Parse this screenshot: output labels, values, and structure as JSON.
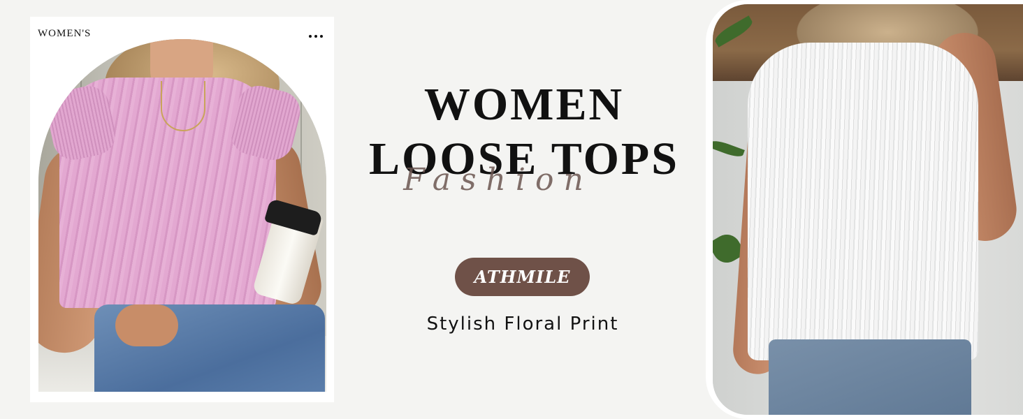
{
  "left_card": {
    "label": "WOMEN'S",
    "more_icon": "more-dots-icon",
    "photo_alt": "Woman in pink textured sleeveless top holding coffee cup"
  },
  "center": {
    "headline_line1": "WOMEN",
    "headline_line2": "LOOSE TOPS",
    "script_word": "Fashion",
    "brand_badge": "ATHMILE",
    "tagline": "Stylish Floral Print"
  },
  "right_image": {
    "photo_alt": "Back view of woman in white textured top and denim shorts"
  },
  "colors": {
    "background": "#f4f4f2",
    "badge": "#6f5148",
    "script": "#6b5651",
    "text": "#111111"
  }
}
